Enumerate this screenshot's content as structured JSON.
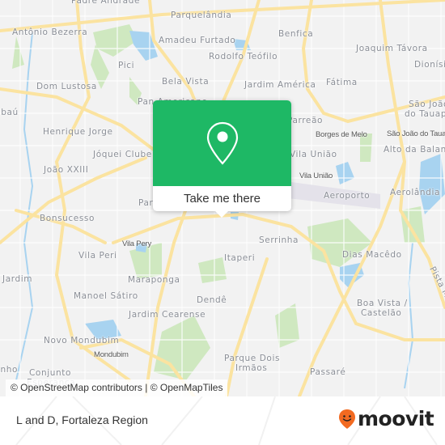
{
  "map": {
    "neighborhood_labels": [
      {
        "text": "Padre Andrade"
      },
      {
        "text": "Parquelândia"
      },
      {
        "text": "Antônio Bezerra"
      },
      {
        "text": "Amadeu Furtado"
      },
      {
        "text": "Benfica"
      },
      {
        "text": "Joaquim Távora"
      },
      {
        "text": "Rodolfo Teófilo"
      },
      {
        "text": "Pici"
      },
      {
        "text": "Dionísio"
      },
      {
        "text": "Dom Lustosa"
      },
      {
        "text": "Bela Vista"
      },
      {
        "text": "Jardim América"
      },
      {
        "text": "Fátima"
      },
      {
        "text": "São João"
      },
      {
        "text": "do Tauape"
      },
      {
        "text": "Pan Americano"
      },
      {
        "text": "Jibaú"
      },
      {
        "text": "Henrique Jorge"
      },
      {
        "text": "Parreão"
      },
      {
        "text": "Alto da Balança"
      },
      {
        "text": "Jóquei Clube"
      },
      {
        "text": "Vila União"
      },
      {
        "text": "João XXIII"
      },
      {
        "text": "Aeroporto"
      },
      {
        "text": "Aerolândia"
      },
      {
        "text": "Parangaba"
      },
      {
        "text": "Bonsucesso"
      },
      {
        "text": "Serrinha"
      },
      {
        "text": "Vila Peri"
      },
      {
        "text": "Itaperi"
      },
      {
        "text": "Dias Macêdo"
      },
      {
        "text": "Jardim"
      },
      {
        "text": "Maraponga"
      },
      {
        "text": "Manoel Sátiro"
      },
      {
        "text": "Dendê"
      },
      {
        "text": "Boa Vista /"
      },
      {
        "text": "Castelão"
      },
      {
        "text": "Jardim Cearense"
      },
      {
        "text": "Novo Mondubim"
      },
      {
        "text": "Parque Dois"
      },
      {
        "text": "Irmãos"
      },
      {
        "text": "Passaré"
      },
      {
        "text": "Conjunto"
      },
      {
        "text": "Esperança"
      },
      {
        "text": "inho"
      },
      {
        "text": "Pista Mar"
      }
    ],
    "station_labels": [
      {
        "text": "Borges de Melo"
      },
      {
        "text": "São João do Tauape"
      },
      {
        "text": "Vila União"
      },
      {
        "text": "Vila Pery"
      },
      {
        "text": "Mondubim"
      }
    ],
    "attribution": "© OpenStreetMap contributors | © OpenMapTiles"
  },
  "popup": {
    "icon": "map-pin-icon",
    "button_label": "Take me there",
    "header_color": "#1eb865"
  },
  "footer": {
    "title": "L and D, Fortaleza Region",
    "logo_text": "moovit",
    "logo_color": "#f26a21"
  }
}
